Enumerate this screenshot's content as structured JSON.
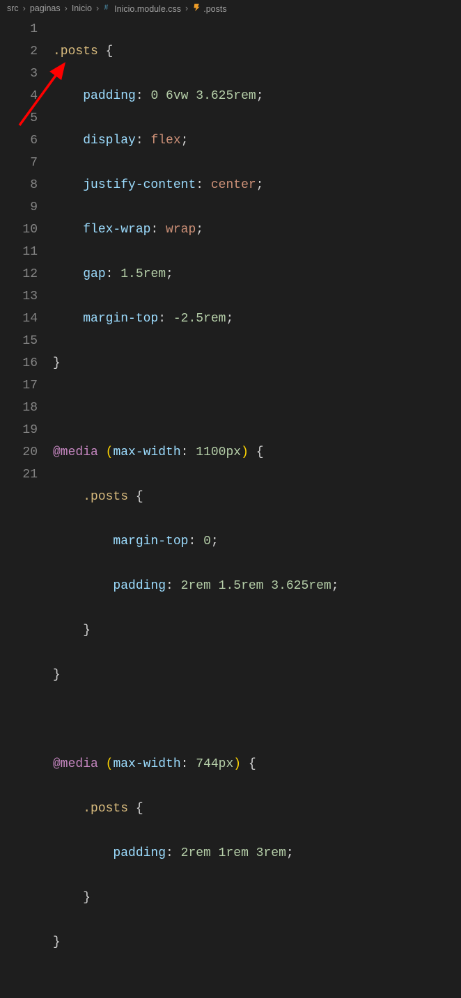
{
  "breadcrumb": {
    "seg0": "src",
    "seg1": "paginas",
    "seg2": "Inicio",
    "seg3": "Inicio.module.css",
    "seg4": ".posts",
    "sep": "›"
  },
  "lines": {
    "n1": "1",
    "n2": "2",
    "n3": "3",
    "n4": "4",
    "n5": "5",
    "n6": "6",
    "n7": "7",
    "n8": "8",
    "n9": "9",
    "n10": "10",
    "n11": "11",
    "n12": "12",
    "n13": "13",
    "n14": "14",
    "n15": "15",
    "n16": "16",
    "n17": "17",
    "n18": "18",
    "n19": "19",
    "n20": "20",
    "n21": "21"
  },
  "code": {
    "sel_posts": ".posts",
    "brace_open": " {",
    "brace_close": "}",
    "prop_padding": "padding",
    "prop_display": "display",
    "prop_justify": "justify-content",
    "prop_flexwrap": "flex-wrap",
    "prop_gap": "gap",
    "prop_margintop": "margin-top",
    "colon": ": ",
    "semi": ";",
    "val_padding1": "0 6vw 3.625rem",
    "val_flex": "flex",
    "val_center": "center",
    "val_wrap": "wrap",
    "val_gap": "1.5rem",
    "val_margintop": "-2.5rem",
    "media": "@media",
    "mq1_cond_prop": "max-width",
    "mq1_cond_val": "1100px",
    "mq2_cond_val": "744px",
    "val_margintop0": "0",
    "val_padding2": "2rem 1.5rem 3.625rem",
    "val_padding3": "2rem 1rem 3rem",
    "paren_open": "(",
    "paren_close": ")",
    "space": " "
  },
  "chart_data": null
}
